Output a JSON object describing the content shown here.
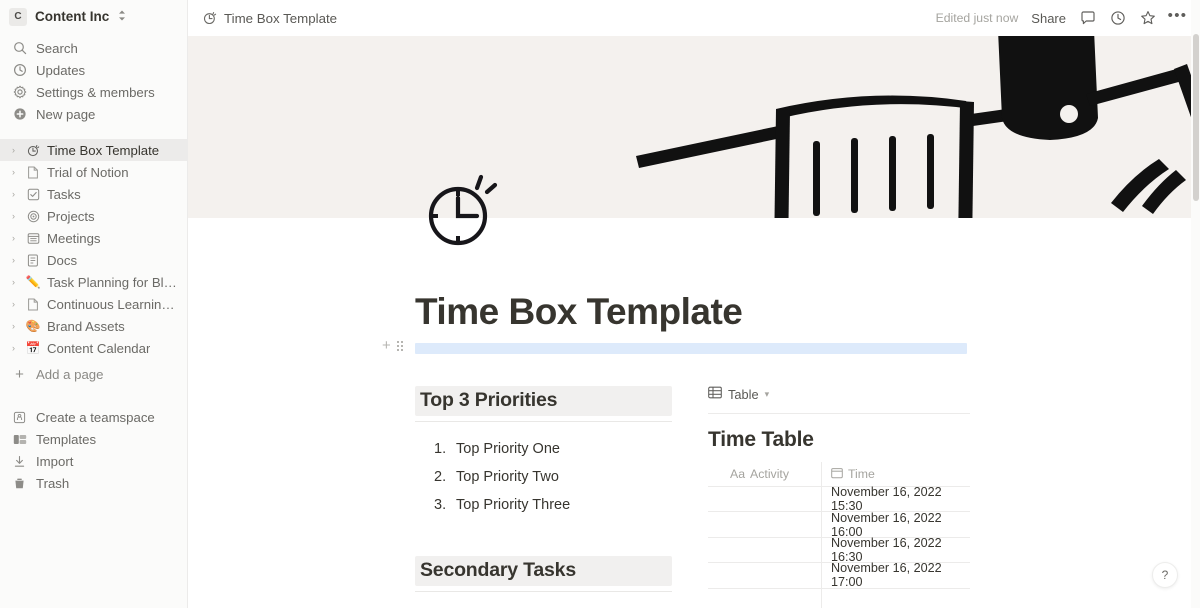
{
  "sidebar": {
    "workspace": {
      "avatar_letter": "C",
      "name": "Content Inc",
      "chevron": "⌃⌄"
    },
    "nav": [
      {
        "label": "Search",
        "icon": "search-icon"
      },
      {
        "label": "Updates",
        "icon": "clock-icon"
      },
      {
        "label": "Settings & members",
        "icon": "gear-icon"
      },
      {
        "label": "New page",
        "icon": "new-page-icon"
      }
    ],
    "pages": [
      {
        "label": "Time Box Template",
        "icon": "timer-icon",
        "selected": true
      },
      {
        "label": "Trial of Notion",
        "icon": "document-icon",
        "selected": false
      },
      {
        "label": "Tasks",
        "icon": "checkbox-icon",
        "selected": false
      },
      {
        "label": "Projects",
        "icon": "target-icon",
        "selected": false
      },
      {
        "label": "Meetings",
        "icon": "calendar-list-icon",
        "selected": false
      },
      {
        "label": "Docs",
        "icon": "doc-lines-icon",
        "selected": false
      },
      {
        "label": "Task Planning for Blog Pr...",
        "icon": "pencil-emoji",
        "selected": false
      },
      {
        "label": "Continuous Learning Pla...",
        "icon": "document-icon",
        "selected": false
      },
      {
        "label": "Brand Assets",
        "icon": "palette-emoji",
        "selected": false
      },
      {
        "label": "Content Calendar",
        "icon": "calendar-emoji",
        "selected": false
      }
    ],
    "add_page": {
      "label": "Add a page",
      "icon": "plus-icon"
    },
    "bottom": [
      {
        "label": "Create a teamspace",
        "icon": "teamspace-icon"
      },
      {
        "label": "Templates",
        "icon": "templates-icon"
      },
      {
        "label": "Import",
        "icon": "import-icon"
      },
      {
        "label": "Trash",
        "icon": "trash-icon"
      }
    ]
  },
  "topbar": {
    "breadcrumb": "Time Box Template",
    "breadcrumb_icon": "timer-icon",
    "edited": "Edited just now",
    "share": "Share",
    "icons": [
      "comment-icon",
      "history-icon",
      "star-icon",
      "more-options-icon"
    ]
  },
  "page": {
    "icon": "timer-icon",
    "title": "Time Box Template",
    "cover_color": "#f4f1ee",
    "selected_block_color": "#ddeafb"
  },
  "left_column": {
    "priorities_heading": "Top 3 Priorities",
    "priorities": [
      {
        "num": "1.",
        "text": "Top Priority One"
      },
      {
        "num": "2.",
        "text": "Top Priority Two"
      },
      {
        "num": "3.",
        "text": "Top Priority Three"
      }
    ],
    "secondary_heading": "Secondary Tasks"
  },
  "right_column": {
    "view_tab": "Table",
    "view_tab_icon": "table-icon",
    "database_title": "Time Table",
    "columns": [
      {
        "label": "Activity",
        "type_icon": "Aa"
      },
      {
        "label": "Time",
        "type_icon": "date-icon"
      }
    ],
    "rows": [
      {
        "activity": "",
        "time": "November 16, 2022 15:30"
      },
      {
        "activity": "",
        "time": "November 16, 2022 16:00"
      },
      {
        "activity": "",
        "time": "November 16, 2022 16:30"
      },
      {
        "activity": "",
        "time": "November 16, 2022 17:00"
      }
    ]
  },
  "help_button": {
    "label": "?"
  }
}
